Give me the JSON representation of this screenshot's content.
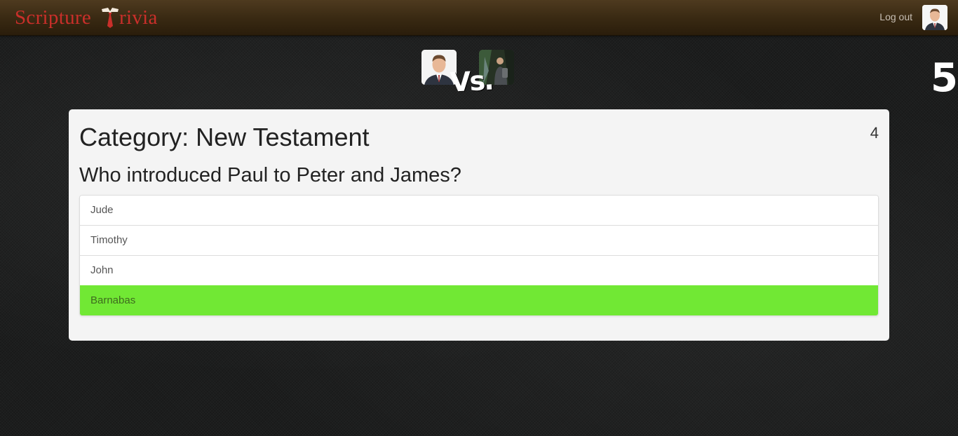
{
  "navbar": {
    "brand_left": "Scripture",
    "brand_right": "rivia",
    "logout_label": "Log out",
    "avatar_icon": "user-avatar-icon"
  },
  "match": {
    "vs_label": "Vs.",
    "player1_icon": "player-avatar-icon",
    "player2_icon": "opponent-avatar-icon",
    "timer": "5"
  },
  "panel": {
    "category": "Category: New Testament",
    "score": "4",
    "question": "Who introduced Paul to Peter and James?",
    "answers": [
      {
        "label": "Jude",
        "state": "normal"
      },
      {
        "label": "Timothy",
        "state": "normal"
      },
      {
        "label": "John",
        "state": "normal"
      },
      {
        "label": "Barnabas",
        "state": "correct"
      }
    ]
  },
  "colors": {
    "brand": "#c92f2a",
    "correct": "#71e834",
    "navbar": "#3a2a13"
  }
}
